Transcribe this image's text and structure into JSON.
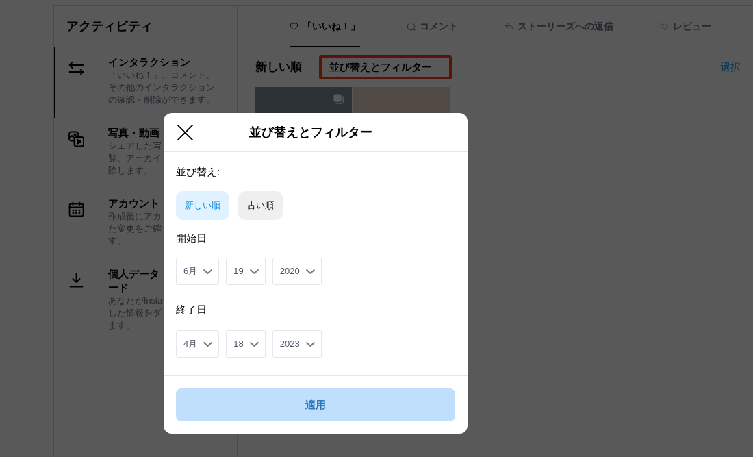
{
  "sidebar": {
    "title": "アクティビティ",
    "items": [
      {
        "title": [
          "インタラクション"
        ],
        "description": [
          "「いいね！」、コメント、",
          "その他のインタラクション",
          "の確認・削除ができます。"
        ],
        "selected": true
      },
      {
        "title": [
          "写真・動画"
        ],
        "description": [
          "シェアした写",
          "覧、アーカイ",
          "除します。"
        ],
        "selected": false
      },
      {
        "title": [
          "アカウント"
        ],
        "description": [
          "作成後にアカ",
          "た変更をご確",
          "す。"
        ],
        "selected": false
      },
      {
        "title": [
          "個人データ",
          "ード"
        ],
        "description": [
          "あなたがInsta",
          "した情報をダ",
          "ます。"
        ],
        "selected": false
      }
    ]
  },
  "tabs": [
    {
      "label": "「いいね！」",
      "selected": true
    },
    {
      "label": "コメント",
      "selected": false
    },
    {
      "label": "ストーリーズへの返信",
      "selected": false
    },
    {
      "label": "レビュー",
      "selected": false
    }
  ],
  "toolbar": {
    "sort_label": "新しい順",
    "filter_button": {
      "label": "並び替えとフィルター",
      "highlighted": true
    },
    "select_link": "選択"
  },
  "photos": [
    {
      "multiple": true
    },
    {
      "multiple": false
    }
  ],
  "modal": {
    "title": "並び替えとフィルター",
    "sort": {
      "label": "並び替え:",
      "options": [
        {
          "label": "新しい順",
          "selected": true
        },
        {
          "label": "古い順",
          "selected": false
        }
      ]
    },
    "date_ranges": [
      {
        "label": "開始日",
        "fields": [
          "6月",
          "19",
          "2020"
        ]
      },
      {
        "label": "終了日",
        "fields": [
          "4月",
          "18",
          "2023"
        ]
      }
    ],
    "apply_button": {
      "label": "適用",
      "disabled": true
    }
  }
}
